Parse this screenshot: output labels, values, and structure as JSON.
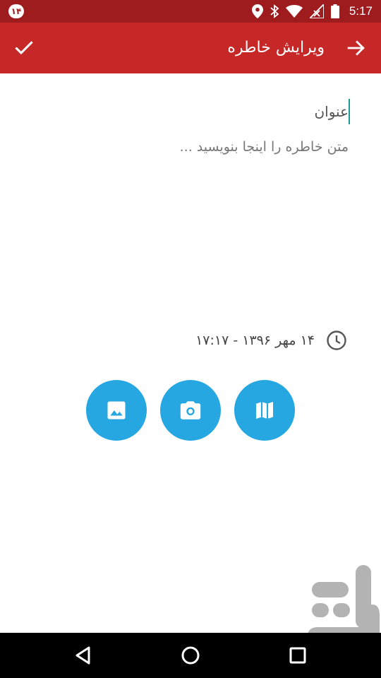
{
  "status_bar": {
    "notification_badge": "۱۴",
    "time": "5:17",
    "icons": [
      "location-icon",
      "bluetooth-icon",
      "wifi-icon",
      "no-signal-icon",
      "battery-icon"
    ]
  },
  "app_bar": {
    "title": "ویرایش خاطره",
    "confirm_icon": "check-icon",
    "back_icon": "arrow-forward-icon",
    "color": "#c62828"
  },
  "editor": {
    "title_placeholder": "عنوان",
    "body_placeholder": "متن خاطره را اینجا بنویسید ..."
  },
  "date_time": {
    "text": "۱۴ مهر ۱۳۹۶ - ۱۷:۱۷",
    "icon": "clock-icon"
  },
  "actions": {
    "color": "#27a7e1",
    "buttons": [
      {
        "icon": "image-icon"
      },
      {
        "icon": "camera-icon"
      },
      {
        "icon": "map-icon"
      }
    ]
  },
  "nav_bar": {
    "icons": [
      "back-triangle-icon",
      "home-circle-icon",
      "recents-square-icon"
    ]
  }
}
